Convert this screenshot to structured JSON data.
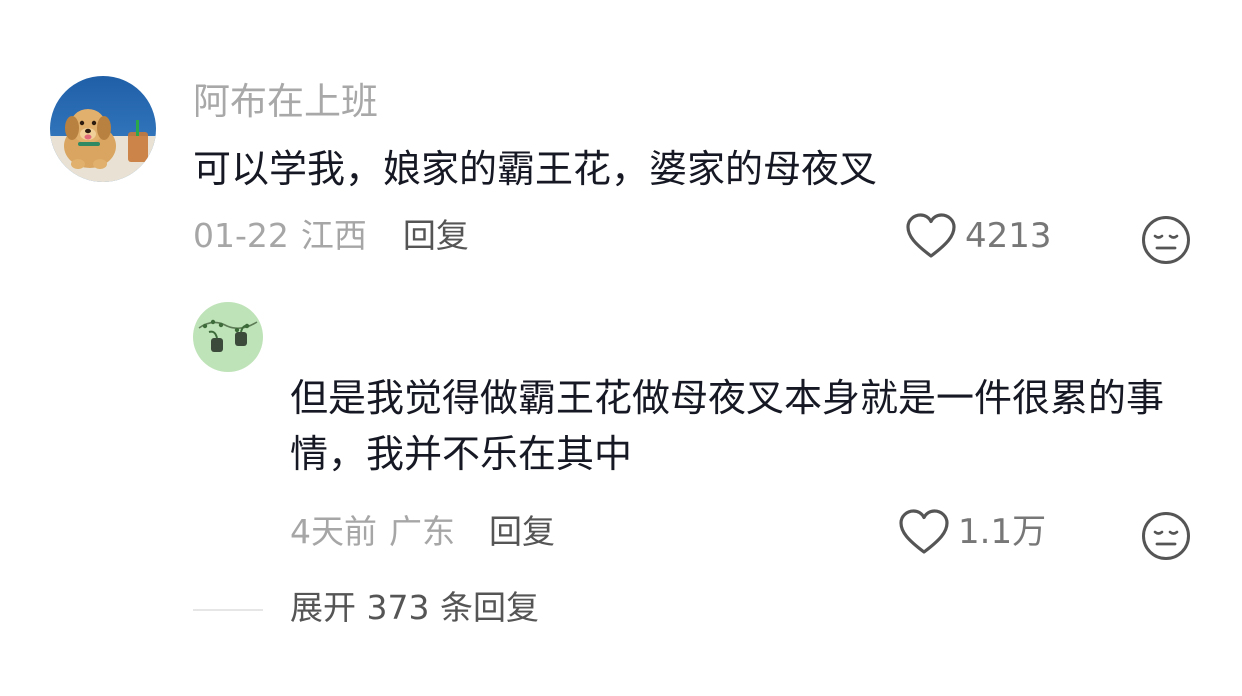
{
  "comments": [
    {
      "username": "阿布在上班",
      "text": "可以学我，娘家的霸王花，婆家的母夜叉",
      "date": "01-22",
      "location": "江西",
      "reply_label": "回复",
      "likes": "4213",
      "avatar_icon": "dog-avatar"
    }
  ],
  "reply": {
    "username": "",
    "text": "但是我觉得做霸王花做母夜叉本身就是一件很累的事情，我并不乐在其中",
    "date": "4天前",
    "location": "广东",
    "reply_label": "回复",
    "likes": "1.1万",
    "avatar_icon": "plant-avatar"
  },
  "expand": {
    "label": "展开 373 条回复"
  },
  "colors": {
    "username": "#a8a8a8",
    "text": "#161823",
    "meta": "#a6a6a6",
    "action": "#555555"
  },
  "icons": {
    "like": "heart-outline-icon",
    "dislike": "neutral-face-icon"
  }
}
